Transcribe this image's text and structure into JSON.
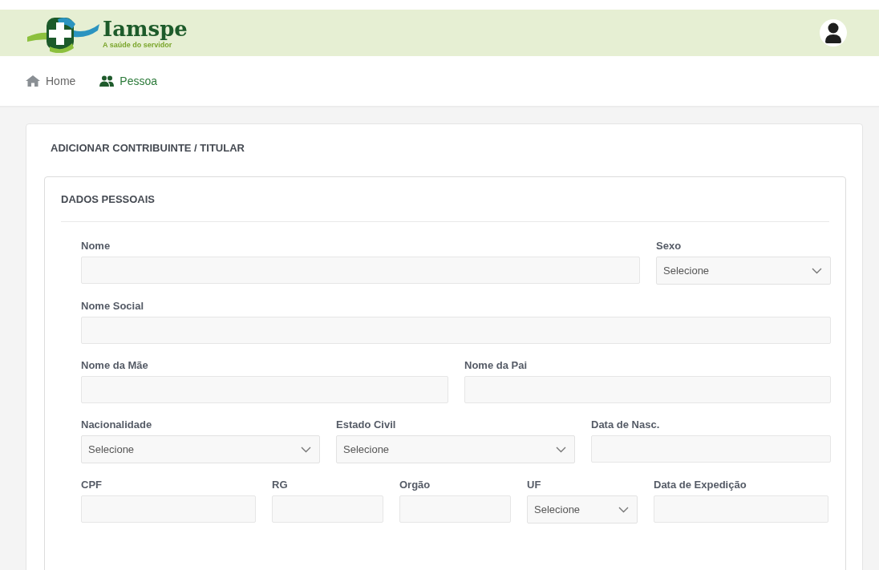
{
  "header": {
    "brand": "Iamspe",
    "tagline": "A saúde do servidor"
  },
  "breadcrumb": [
    {
      "label": "Home",
      "kind": "home",
      "selected": false
    },
    {
      "label": "Pessoa",
      "kind": "people",
      "selected": true
    }
  ],
  "card": {
    "title": "ADICIONAR CONTRIBUINTE / TITULAR"
  },
  "section": {
    "title": "DADOS PESSOAIS",
    "fields": [
      {
        "label": "Nome",
        "kind": "input"
      },
      {
        "label": "Sexo",
        "kind": "select",
        "value": "Selecione"
      },
      {
        "label": "Nome Social",
        "kind": "input"
      },
      {
        "label": "Nome da Mãe",
        "kind": "input"
      },
      {
        "label": "Nome da Pai",
        "kind": "input"
      },
      {
        "label": "Nacionalidade",
        "kind": "select",
        "value": "Selecione"
      },
      {
        "label": "Estado Civil",
        "kind": "select",
        "value": "Selecione"
      },
      {
        "label": "Data de Nasc.",
        "kind": "input"
      },
      {
        "label": "CPF",
        "kind": "input"
      },
      {
        "label": "RG",
        "kind": "input"
      },
      {
        "label": "Orgão",
        "kind": "input"
      },
      {
        "label": "UF",
        "kind": "select",
        "value": "Selecione"
      },
      {
        "label": "Data de Expedição",
        "kind": "input"
      }
    ]
  }
}
